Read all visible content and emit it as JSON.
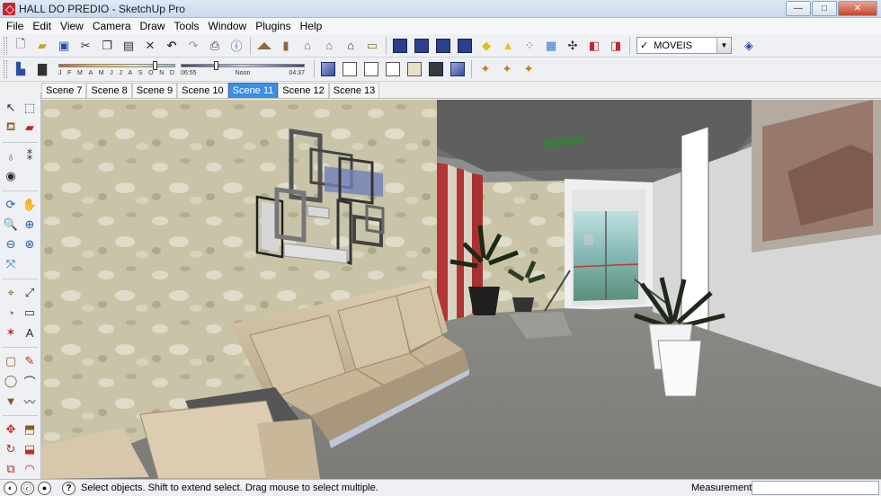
{
  "window": {
    "title": "HALL DO PREDIO - SketchUp Pro",
    "buttons": {
      "minimize": "—",
      "maximize": "□",
      "close": "✕"
    }
  },
  "menu": [
    "File",
    "Edit",
    "View",
    "Camera",
    "Draw",
    "Tools",
    "Window",
    "Plugins",
    "Help"
  ],
  "toolbar1": {
    "layer_selector": {
      "value": "MOVEIS",
      "checkmark": "✓"
    }
  },
  "shadows": {
    "months": [
      "J",
      "F",
      "M",
      "A",
      "M",
      "J",
      "J",
      "A",
      "S",
      "O",
      "N",
      "D"
    ],
    "month_position": 0.84,
    "time_start": "06:55",
    "time_mid": "Noon",
    "time_end": "04:37",
    "time_position": 0.28
  },
  "scenes": {
    "tabs": [
      "Scene 7",
      "Scene 8",
      "Scene 9",
      "Scene 10",
      "Scene 11",
      "Scene 12",
      "Scene 13"
    ],
    "active_index": 4
  },
  "statusbar": {
    "message": "Select objects. Shift to extend select. Drag mouse to select multiple.",
    "measurements_label": "Measurements",
    "measurements_value": ""
  },
  "colors": {
    "accent_blue": "#3a8ee6",
    "wall_texture": "#c9c4a8",
    "sofa": "#c8b79a",
    "ceiling": "#6f6f6f",
    "floor": "#8c8c8c",
    "red_panel": "#b83a3a"
  }
}
